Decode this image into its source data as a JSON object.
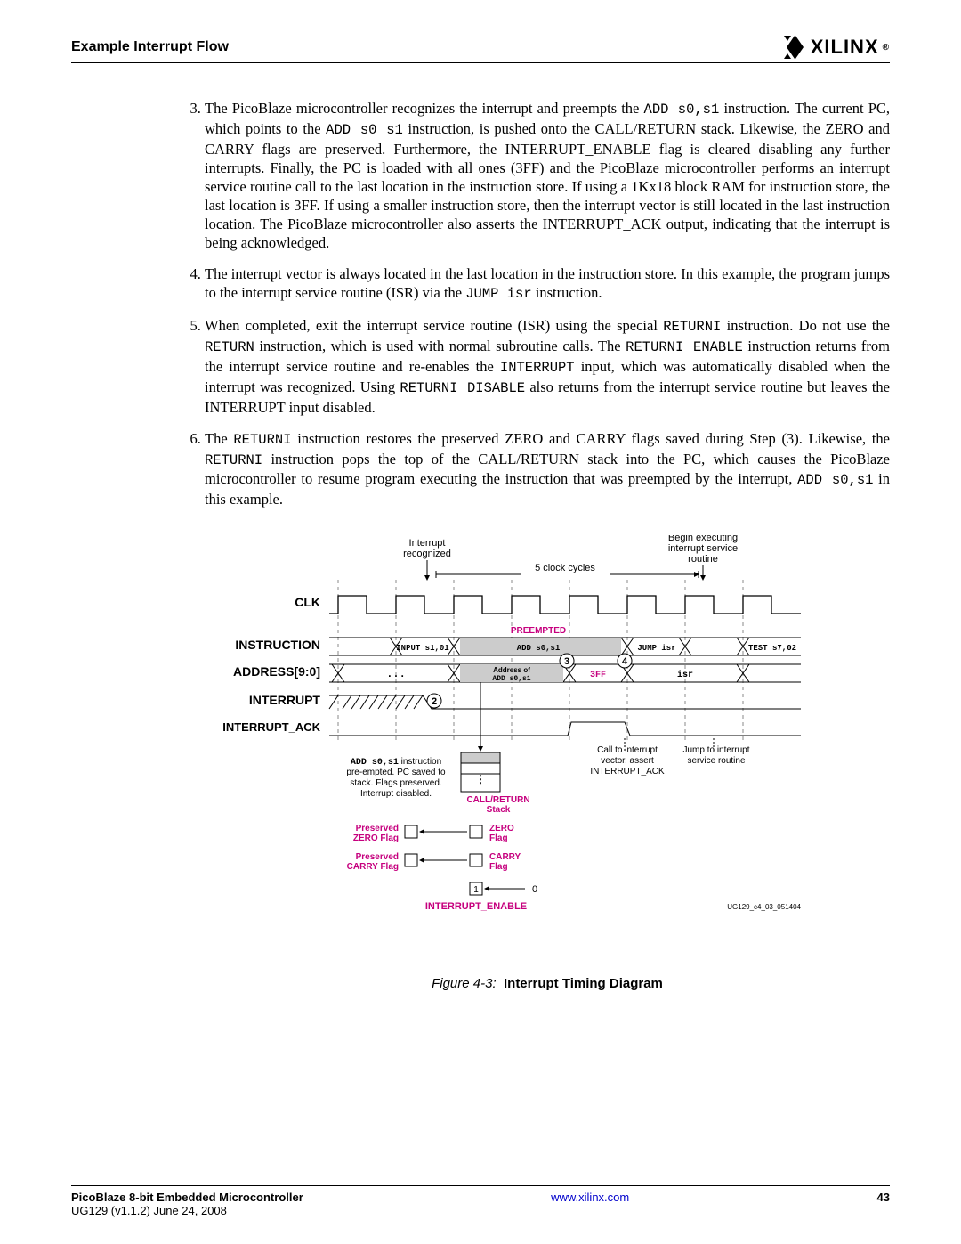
{
  "header": {
    "title": "Example Interrupt Flow",
    "logo_text": "XILINX",
    "logo_reg": "®"
  },
  "list": {
    "start": 3,
    "items": [
      {
        "parts": [
          {
            "t": "text",
            "v": "The PicoBlaze microcontroller recognizes the interrupt and preempts the "
          },
          {
            "t": "mono",
            "v": "ADD s0,s1"
          },
          {
            "t": "text",
            "v": " instruction. The current PC, which points to the "
          },
          {
            "t": "mono",
            "v": "ADD s0 s1"
          },
          {
            "t": "text",
            "v": " instruction, is pushed onto the CALL/RETURN stack. Likewise, the ZERO and CARRY flags are preserved. Furthermore, the INTERRUPT_ENABLE flag is cleared disabling any further interrupts. Finally, the PC is loaded with all ones (3FF) and the PicoBlaze microcontroller performs an interrupt service routine call to the last location in the instruction store. If using a 1Kx18 block RAM for instruction store, the last location is 3FF. If using a smaller instruction store, then the interrupt vector is still located in the last instruction location. The PicoBlaze microcontroller also asserts the INTERRUPT_ACK output, indicating that the interrupt is being acknowledged."
          }
        ]
      },
      {
        "parts": [
          {
            "t": "text",
            "v": "The interrupt vector is always located in the last location in the instruction store. In this example, the program jumps to the interrupt service routine (ISR) via the "
          },
          {
            "t": "mono",
            "v": "JUMP isr"
          },
          {
            "t": "text",
            "v": " instruction."
          }
        ]
      },
      {
        "parts": [
          {
            "t": "text",
            "v": "When completed, exit the interrupt service routine (ISR) using the special "
          },
          {
            "t": "mono",
            "v": "RETURNI"
          },
          {
            "t": "text",
            "v": " instruction. Do not use the "
          },
          {
            "t": "mono",
            "v": "RETURN"
          },
          {
            "t": "text",
            "v": " instruction, which is used with normal subroutine calls. The "
          },
          {
            "t": "mono",
            "v": "RETURNI ENABLE"
          },
          {
            "t": "text",
            "v": " instruction returns from the interrupt service routine and re-enables the "
          },
          {
            "t": "mono",
            "v": "INTERRUPT"
          },
          {
            "t": "text",
            "v": " input, which was automatically disabled when the interrupt was recognized. Using "
          },
          {
            "t": "mono",
            "v": "RETURNI DISABLE"
          },
          {
            "t": "text",
            "v": " also returns from the interrupt service routine but leaves the INTERRUPT input disabled."
          }
        ]
      },
      {
        "parts": [
          {
            "t": "text",
            "v": "The "
          },
          {
            "t": "mono",
            "v": "RETURNI"
          },
          {
            "t": "text",
            "v": " instruction restores the preserved ZERO and CARRY flags saved during Step (3). Likewise, the "
          },
          {
            "t": "mono",
            "v": "RETURNI"
          },
          {
            "t": "text",
            "v": " instruction pops the top of the CALL/RETURN stack into the PC, which causes the PicoBlaze microcontroller to resume program executing the instruction that was preempted by the interrupt, "
          },
          {
            "t": "mono",
            "v": "ADD s0,s1"
          },
          {
            "t": "text",
            "v": " in this example."
          }
        ]
      }
    ]
  },
  "figure": {
    "labels": {
      "interrupt_recognized": "Interrupt\nrecognized",
      "begin_exec": "Begin executing\ninterrupt service\nroutine",
      "five_cycles": "5 clock cycles",
      "clk": "CLK",
      "instruction": "INSTRUCTION",
      "address": "ADDRESS[9:0]",
      "interrupt": "INTERRUPT",
      "interrupt_ack": "INTERRUPT_ACK",
      "preempted": "PREEMPTED",
      "instr_input": "INPUT s1,01",
      "instr_add": "ADD s0,s1",
      "instr_jump": "JUMP isr",
      "instr_test": "TEST s7,02",
      "addr_dots": "...",
      "addr_of": "Address of\nADD s0,s1",
      "addr_3ff": "3FF",
      "addr_isr": "isr",
      "note_preempt": "ADD s0,s1 instruction\npre-empted. PC saved to\nstack. Flags preserved.\nInterrupt disabled.",
      "note_call_vec": "Call to interrupt\nvector, assert\nINTERRUPT_ACK",
      "note_jump": "Jump to interrupt\nservice routine",
      "call_stack": "CALL/RETURN\nStack",
      "pres_zero": "Preserved\nZERO Flag",
      "zero_flag": "ZERO\nFlag",
      "pres_carry": "Preserved\nCARRY Flag",
      "carry_flag": "CARRY\nFlag",
      "int_enable": "INTERRUPT_ENABLE",
      "zero_val": "0",
      "one_val": "1",
      "marker_2": "2",
      "marker_3": "3",
      "marker_4": "4",
      "figref": "UG129_c4_03_051404"
    },
    "caption_prefix": "Figure 4-3:",
    "caption_title": "Interrupt Timing Diagram"
  },
  "footer": {
    "left_bold": "PicoBlaze 8-bit Embedded Microcontroller",
    "left_sub": "UG129 (v1.1.2) June 24, 2008",
    "link": "www.xilinx.com",
    "page": "43"
  }
}
